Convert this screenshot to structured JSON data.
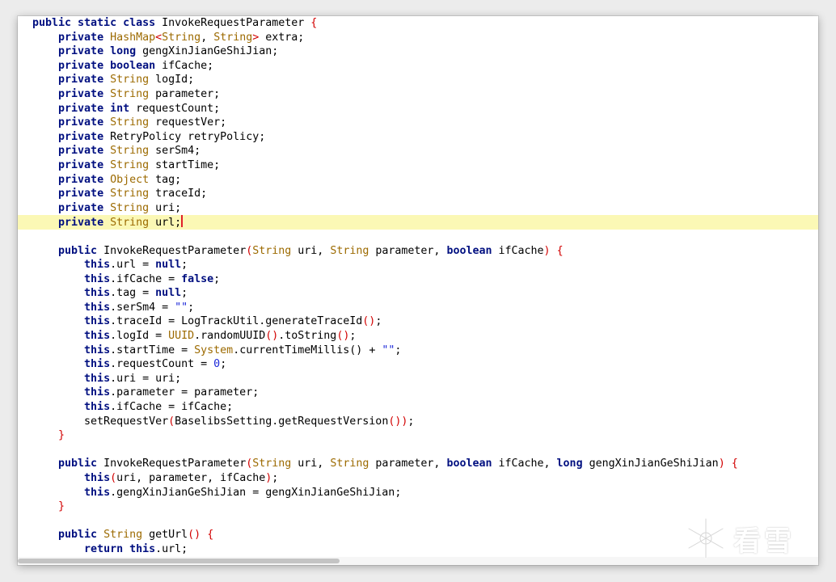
{
  "editor": {
    "lines": [
      [
        {
          "t": "public static class ",
          "c": "kw"
        },
        {
          "t": "InvokeRequestParameter ",
          "c": "ref"
        },
        {
          "t": "{",
          "c": "par"
        }
      ],
      [
        {
          "t": "    "
        },
        {
          "t": "private ",
          "c": "kw"
        },
        {
          "t": "HashMap",
          "c": "type"
        },
        {
          "t": "<",
          "c": "par"
        },
        {
          "t": "String",
          "c": "type"
        },
        {
          "t": ", "
        },
        {
          "t": "String",
          "c": "type"
        },
        {
          "t": ">",
          "c": "par"
        },
        {
          "t": " extra;"
        }
      ],
      [
        {
          "t": "    "
        },
        {
          "t": "private ",
          "c": "kw"
        },
        {
          "t": "long",
          "c": "kw"
        },
        {
          "t": " gengXinJianGeShiJian;"
        }
      ],
      [
        {
          "t": "    "
        },
        {
          "t": "private ",
          "c": "kw"
        },
        {
          "t": "boolean",
          "c": "kw"
        },
        {
          "t": " ifCache;"
        }
      ],
      [
        {
          "t": "    "
        },
        {
          "t": "private ",
          "c": "kw"
        },
        {
          "t": "String",
          "c": "type"
        },
        {
          "t": " logId;"
        }
      ],
      [
        {
          "t": "    "
        },
        {
          "t": "private ",
          "c": "kw"
        },
        {
          "t": "String",
          "c": "type"
        },
        {
          "t": " parameter;"
        }
      ],
      [
        {
          "t": "    "
        },
        {
          "t": "private ",
          "c": "kw"
        },
        {
          "t": "int",
          "c": "kw"
        },
        {
          "t": " requestCount;"
        }
      ],
      [
        {
          "t": "    "
        },
        {
          "t": "private ",
          "c": "kw"
        },
        {
          "t": "String",
          "c": "type"
        },
        {
          "t": " requestVer;"
        }
      ],
      [
        {
          "t": "    "
        },
        {
          "t": "private ",
          "c": "kw"
        },
        {
          "t": "RetryPolicy retryPolicy;"
        }
      ],
      [
        {
          "t": "    "
        },
        {
          "t": "private ",
          "c": "kw"
        },
        {
          "t": "String",
          "c": "type"
        },
        {
          "t": " serSm4;"
        }
      ],
      [
        {
          "t": "    "
        },
        {
          "t": "private ",
          "c": "kw"
        },
        {
          "t": "String",
          "c": "type"
        },
        {
          "t": " startTime;"
        }
      ],
      [
        {
          "t": "    "
        },
        {
          "t": "private ",
          "c": "kw"
        },
        {
          "t": "Object",
          "c": "type"
        },
        {
          "t": " tag;"
        }
      ],
      [
        {
          "t": "    "
        },
        {
          "t": "private ",
          "c": "kw"
        },
        {
          "t": "String",
          "c": "type"
        },
        {
          "t": " traceId;"
        }
      ],
      [
        {
          "t": "    "
        },
        {
          "t": "private ",
          "c": "kw"
        },
        {
          "t": "String",
          "c": "type"
        },
        {
          "t": " uri;"
        }
      ],
      [
        {
          "t": "    "
        },
        {
          "t": "private ",
          "c": "kw"
        },
        {
          "t": "String",
          "c": "type"
        },
        {
          "t": " url;"
        },
        {
          "t": "",
          "c": "cur"
        }
      ],
      [],
      [
        {
          "t": "    "
        },
        {
          "t": "public ",
          "c": "kw"
        },
        {
          "t": "InvokeRequestParameter"
        },
        {
          "t": "(",
          "c": "par"
        },
        {
          "t": "String",
          "c": "type"
        },
        {
          "t": " uri, "
        },
        {
          "t": "String",
          "c": "type"
        },
        {
          "t": " parameter, "
        },
        {
          "t": "boolean",
          "c": "kw"
        },
        {
          "t": " ifCache"
        },
        {
          "t": ")",
          "c": "par"
        },
        {
          "t": " "
        },
        {
          "t": "{",
          "c": "par"
        }
      ],
      [
        {
          "t": "        "
        },
        {
          "t": "this",
          "c": "kw"
        },
        {
          "t": ".url = "
        },
        {
          "t": "null",
          "c": "kw"
        },
        {
          "t": ";"
        }
      ],
      [
        {
          "t": "        "
        },
        {
          "t": "this",
          "c": "kw"
        },
        {
          "t": ".ifCache = "
        },
        {
          "t": "false",
          "c": "kw"
        },
        {
          "t": ";"
        }
      ],
      [
        {
          "t": "        "
        },
        {
          "t": "this",
          "c": "kw"
        },
        {
          "t": ".tag = "
        },
        {
          "t": "null",
          "c": "kw"
        },
        {
          "t": ";"
        }
      ],
      [
        {
          "t": "        "
        },
        {
          "t": "this",
          "c": "kw"
        },
        {
          "t": ".serSm4 = "
        },
        {
          "t": "\"\"",
          "c": "str"
        },
        {
          "t": ";"
        }
      ],
      [
        {
          "t": "        "
        },
        {
          "t": "this",
          "c": "kw"
        },
        {
          "t": ".traceId = LogTrackUtil.generateTraceId"
        },
        {
          "t": "()",
          "c": "par"
        },
        {
          "t": ";"
        }
      ],
      [
        {
          "t": "        "
        },
        {
          "t": "this",
          "c": "kw"
        },
        {
          "t": ".logId = "
        },
        {
          "t": "UUID",
          "c": "type"
        },
        {
          "t": ".randomUUID"
        },
        {
          "t": "()",
          "c": "par"
        },
        {
          "t": ".toString"
        },
        {
          "t": "()",
          "c": "par"
        },
        {
          "t": ";"
        }
      ],
      [
        {
          "t": "        "
        },
        {
          "t": "this",
          "c": "kw"
        },
        {
          "t": ".startTime = "
        },
        {
          "t": "System",
          "c": "type"
        },
        {
          "t": ".currentTimeMillis() + "
        },
        {
          "t": "\"\"",
          "c": "str"
        },
        {
          "t": ";"
        }
      ],
      [
        {
          "t": "        "
        },
        {
          "t": "this",
          "c": "kw"
        },
        {
          "t": ".requestCount = "
        },
        {
          "t": "0",
          "c": "num"
        },
        {
          "t": ";"
        }
      ],
      [
        {
          "t": "        "
        },
        {
          "t": "this",
          "c": "kw"
        },
        {
          "t": ".uri = uri;"
        }
      ],
      [
        {
          "t": "        "
        },
        {
          "t": "this",
          "c": "kw"
        },
        {
          "t": ".parameter = parameter;"
        }
      ],
      [
        {
          "t": "        "
        },
        {
          "t": "this",
          "c": "kw"
        },
        {
          "t": ".ifCache = ifCache;"
        }
      ],
      [
        {
          "t": "        setRequestVer"
        },
        {
          "t": "(",
          "c": "par"
        },
        {
          "t": "BaselibsSetting.getRequestVersion"
        },
        {
          "t": "())",
          "c": "par"
        },
        {
          "t": ";"
        }
      ],
      [
        {
          "t": "    "
        },
        {
          "t": "}",
          "c": "par"
        }
      ],
      [],
      [
        {
          "t": "    "
        },
        {
          "t": "public ",
          "c": "kw"
        },
        {
          "t": "InvokeRequestParameter"
        },
        {
          "t": "(",
          "c": "par"
        },
        {
          "t": "String",
          "c": "type"
        },
        {
          "t": " uri, "
        },
        {
          "t": "String",
          "c": "type"
        },
        {
          "t": " parameter, "
        },
        {
          "t": "boolean",
          "c": "kw"
        },
        {
          "t": " ifCache, "
        },
        {
          "t": "long",
          "c": "kw"
        },
        {
          "t": " gengXinJianGeShiJian"
        },
        {
          "t": ")",
          "c": "par"
        },
        {
          "t": " "
        },
        {
          "t": "{",
          "c": "par"
        }
      ],
      [
        {
          "t": "        "
        },
        {
          "t": "this",
          "c": "kw"
        },
        {
          "t": "(",
          "c": "par"
        },
        {
          "t": "uri, parameter, ifCache"
        },
        {
          "t": ")",
          "c": "par"
        },
        {
          "t": ";"
        }
      ],
      [
        {
          "t": "        "
        },
        {
          "t": "this",
          "c": "kw"
        },
        {
          "t": ".gengXinJianGeShiJian = gengXinJianGeShiJian;"
        }
      ],
      [
        {
          "t": "    "
        },
        {
          "t": "}",
          "c": "par"
        }
      ],
      [],
      [
        {
          "t": "    "
        },
        {
          "t": "public ",
          "c": "kw"
        },
        {
          "t": "String",
          "c": "type"
        },
        {
          "t": " getUrl"
        },
        {
          "t": "()",
          "c": "par"
        },
        {
          "t": " "
        },
        {
          "t": "{",
          "c": "par"
        }
      ],
      [
        {
          "t": "        "
        },
        {
          "t": "return ",
          "c": "kw"
        },
        {
          "t": "this",
          "c": "kw"
        },
        {
          "t": ".url;"
        }
      ]
    ],
    "highlight_line": 14
  },
  "watermark": {
    "text": "看雪"
  },
  "colors": {
    "keyword": "#000f80",
    "type": "#9c6a00",
    "string": "#1b27d8",
    "paren": "#d20000",
    "highlight": "#fbf8b5",
    "cursor": "#e0202a"
  }
}
